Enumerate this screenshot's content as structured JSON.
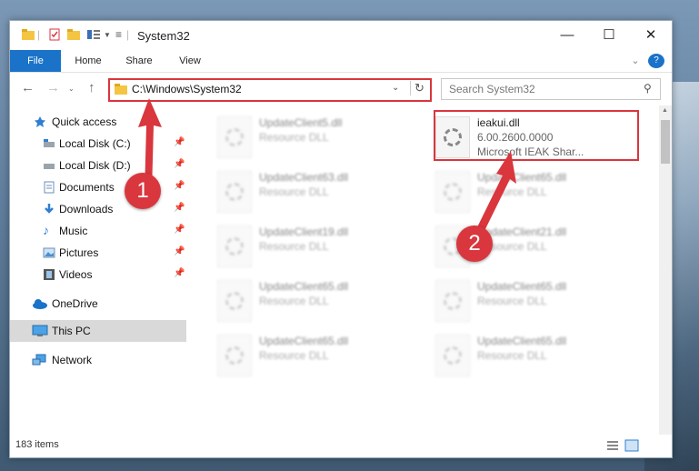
{
  "window": {
    "title": "System32",
    "minimize": "—",
    "maximize": "☐",
    "close": "✕"
  },
  "ribbon": {
    "file": "File",
    "home": "Home",
    "share": "Share",
    "view": "View",
    "help": "?"
  },
  "address": {
    "path": "C:\\Windows\\System32",
    "search_placeholder": "Search System32"
  },
  "sidebar": {
    "quick_access": "Quick access",
    "items": [
      {
        "label": "Local Disk (C:)"
      },
      {
        "label": "Local Disk (D:)"
      },
      {
        "label": "Documents"
      },
      {
        "label": "Downloads"
      },
      {
        "label": "Music"
      },
      {
        "label": "Pictures"
      },
      {
        "label": "Videos"
      }
    ],
    "onedrive": "OneDrive",
    "this_pc": "This PC",
    "network": "Network"
  },
  "files": {
    "left": [
      {
        "name": "UpdateClient5.dll",
        "desc": "Resource DLL"
      },
      {
        "name": "UpdateClient63.dll",
        "desc": "Resource DLL"
      },
      {
        "name": "UpdateClient19.dll",
        "desc": "Resource DLL"
      },
      {
        "name": "UpdateClient65.dll",
        "desc": "Resource DLL"
      },
      {
        "name": "UpdateClient65.dll",
        "desc": "Resource DLL"
      }
    ],
    "highlighted": {
      "name": "ieakui.dll",
      "version": "6.00.2600.0000",
      "desc": "Microsoft IEAK Shar..."
    },
    "right": [
      {
        "name": "UpdateClient65.dll",
        "desc": "Resource DLL"
      },
      {
        "name": "UpdateClient21.dll",
        "desc": "Resource DLL"
      },
      {
        "name": "UpdateClient65.dll",
        "desc": "Resource DLL"
      },
      {
        "name": "UpdateClient65.dll",
        "desc": "Resource DLL"
      }
    ]
  },
  "status": {
    "count": "183 items"
  },
  "annotations": {
    "step1": "1",
    "step2": "2"
  },
  "colors": {
    "accent": "#1a73c8",
    "highlight": "#d9363e"
  }
}
